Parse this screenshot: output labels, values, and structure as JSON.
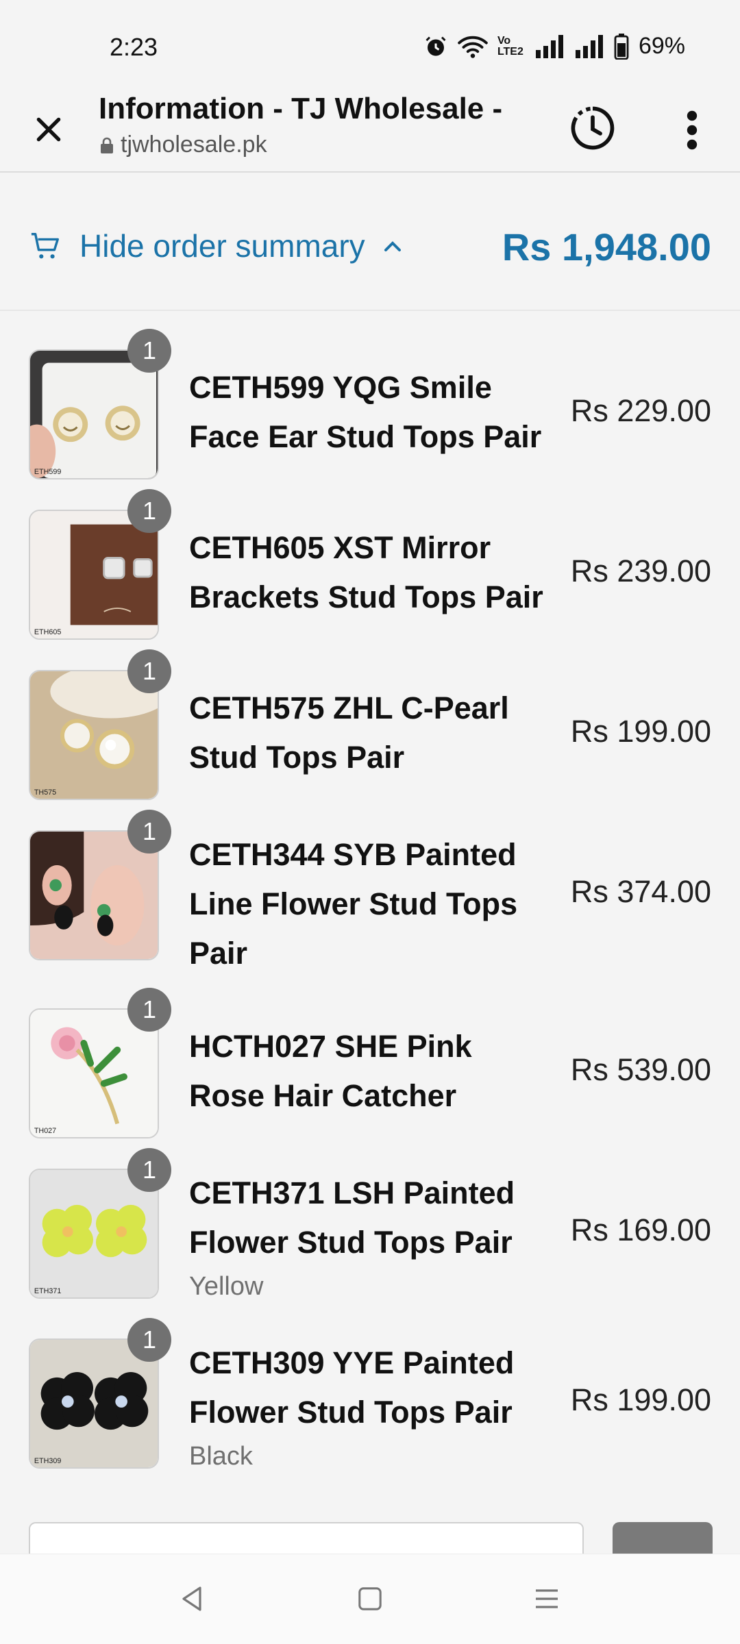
{
  "status_bar": {
    "time": "2:23",
    "network_label": "Vo LTE2",
    "battery": "69%"
  },
  "browser": {
    "page_title": "Information - TJ Wholesale -",
    "url": "tjwholesale.pk"
  },
  "order_summary": {
    "toggle_label": "Hide order summary",
    "total": "Rs 1,948.00",
    "accent_color": "#1b73a8"
  },
  "products": [
    {
      "name": "CETH599 YQG Smile Face Ear Stud Tops Pair",
      "price": "Rs 229.00",
      "qty": "1",
      "variant": "",
      "thumb_code": "ETH599",
      "image": "smile-face-stud-earrings"
    },
    {
      "name": "CETH605 XST Mirror Brackets Stud Tops Pair",
      "price": "Rs 239.00",
      "qty": "1",
      "variant": "",
      "thumb_code": "ETH605",
      "image": "mirror-bracket-stud-earrings"
    },
    {
      "name": "CETH575 ZHL C-Pearl Stud Tops Pair",
      "price": "Rs 199.00",
      "qty": "1",
      "variant": "",
      "thumb_code": "TH575",
      "image": "c-pearl-stud-earrings"
    },
    {
      "name": "CETH344 SYB Painted Line Flower Stud Tops Pair",
      "price": "Rs 374.00",
      "qty": "1",
      "variant": "",
      "thumb_code": "",
      "image": "painted-flower-stud-earrings"
    },
    {
      "name": "HCTH027 SHE Pink Rose Hair Catcher",
      "price": "Rs 539.00",
      "qty": "1",
      "variant": "",
      "thumb_code": "TH027",
      "image": "pink-rose-hair-catcher"
    },
    {
      "name": "CETH371 LSH Painted Flower Stud Tops Pair",
      "price": "Rs 169.00",
      "qty": "1",
      "variant": "Yellow",
      "thumb_code": "ETH371",
      "image": "yellow-flower-stud-earrings"
    },
    {
      "name": "CETH309 YYE Painted Flower Stud Tops Pair",
      "price": "Rs 199.00",
      "qty": "1",
      "variant": "Black",
      "thumb_code": "ETH309",
      "image": "black-flower-stud-earrings"
    }
  ]
}
